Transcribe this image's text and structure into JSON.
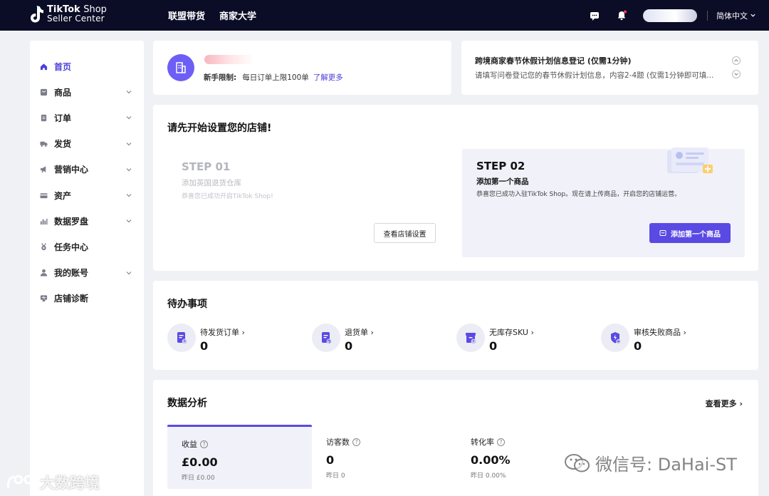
{
  "brand": {
    "line1": "TikTok",
    "line1b": "Shop",
    "line2": "Seller Center"
  },
  "topnav": [
    {
      "label": "联盟带货"
    },
    {
      "label": "商家大学"
    }
  ],
  "topright": {
    "language": "简体中文"
  },
  "sidebar": {
    "items": [
      {
        "label": "首页",
        "icon": "home-icon",
        "expandable": false,
        "active": true
      },
      {
        "label": "商品",
        "icon": "product-icon",
        "expandable": true
      },
      {
        "label": "订单",
        "icon": "order-icon",
        "expandable": true
      },
      {
        "label": "发货",
        "icon": "truck-icon",
        "expandable": true
      },
      {
        "label": "营销中心",
        "icon": "megaphone-icon",
        "expandable": true
      },
      {
        "label": "资产",
        "icon": "card-icon",
        "expandable": true
      },
      {
        "label": "数据罗盘",
        "icon": "chart-icon",
        "expandable": true
      },
      {
        "label": "任务中心",
        "icon": "medal-icon",
        "expandable": false
      },
      {
        "label": "我的账号",
        "icon": "user-icon",
        "expandable": true
      },
      {
        "label": "店铺诊断",
        "icon": "diagnosis-icon",
        "expandable": false
      }
    ]
  },
  "notice": {
    "limit_label": "新手限制:",
    "limit_text": "每日订单上限100单",
    "learn_more": "了解更多"
  },
  "holiday": {
    "title": "跨境商家春节休假计划信息登记 (仅需1分钟)",
    "text": "请填写问卷登记您的春节休假计划信息，内容2-4题 (仅需1分钟即可填..."
  },
  "setup": {
    "title": "请先开始设置您的店铺!",
    "step1": {
      "head": "STEP 01",
      "title": "添加英国退货仓库",
      "desc": "恭喜您已成功开启TikTok Shop!",
      "button": "查看店铺设置"
    },
    "step2": {
      "head": "STEP 02",
      "title": "添加第一个商品",
      "desc": "恭喜您已成功入驻TikTok Shop。现在请上传商品，开启您的店铺运营。",
      "button": "添加第一个商品"
    }
  },
  "todo": {
    "title": "待办事项",
    "items": [
      {
        "label": "待发货订单",
        "count": "0",
        "icon": "pending-order-icon"
      },
      {
        "label": "退货单",
        "count": "0",
        "icon": "return-icon"
      },
      {
        "label": "无库存SKU",
        "count": "0",
        "icon": "out-of-stock-icon"
      },
      {
        "label": "审核失败商品",
        "count": "0",
        "icon": "review-failed-icon"
      }
    ]
  },
  "analytics": {
    "title": "数据分析",
    "more": "查看更多",
    "metrics": [
      {
        "label": "收益",
        "value": "£0.00",
        "sub": "昨日 £0.00"
      },
      {
        "label": "访客数",
        "value": "0",
        "sub": "昨日 0"
      },
      {
        "label": "转化率",
        "value": "0.00%",
        "sub": "昨日 0.00%"
      }
    ]
  },
  "watermarks": {
    "wechat": "微信号: DaHai-ST",
    "brand": "大数跨境"
  },
  "colors": {
    "topbar": "#0b0c26",
    "accent": "#5a4ae3",
    "page_bg": "#f0f1f5"
  }
}
